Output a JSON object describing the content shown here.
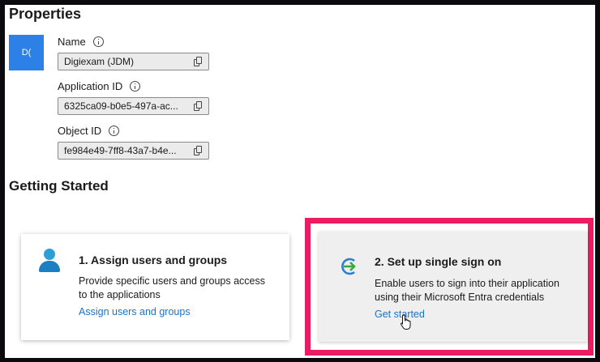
{
  "properties": {
    "heading": "Properties",
    "avatar_text": "D(",
    "name": {
      "label": "Name",
      "value": "Digiexam (JDM)"
    },
    "application_id": {
      "label": "Application ID",
      "value": "6325ca09-b0e5-497a-ac..."
    },
    "object_id": {
      "label": "Object ID",
      "value": "fe984e49-7ff8-43a7-b4e..."
    }
  },
  "getting_started": {
    "heading": "Getting Started",
    "cards": [
      {
        "title": "1. Assign users and groups",
        "desc_line1": "Provide specific users and groups access",
        "desc_line2": "to the applications",
        "link": "Assign users and groups",
        "icon": "user-icon"
      },
      {
        "title": "2. Set up single sign on",
        "desc_line1": "Enable users to sign into their application",
        "desc_line2": "using their Microsoft Entra credentials",
        "link": "Get started",
        "icon": "sign-in-arrow-icon"
      }
    ]
  },
  "colors": {
    "highlight_border": "#ec1c62",
    "avatar_bg": "#2c80e6",
    "link": "#1a73c7"
  }
}
